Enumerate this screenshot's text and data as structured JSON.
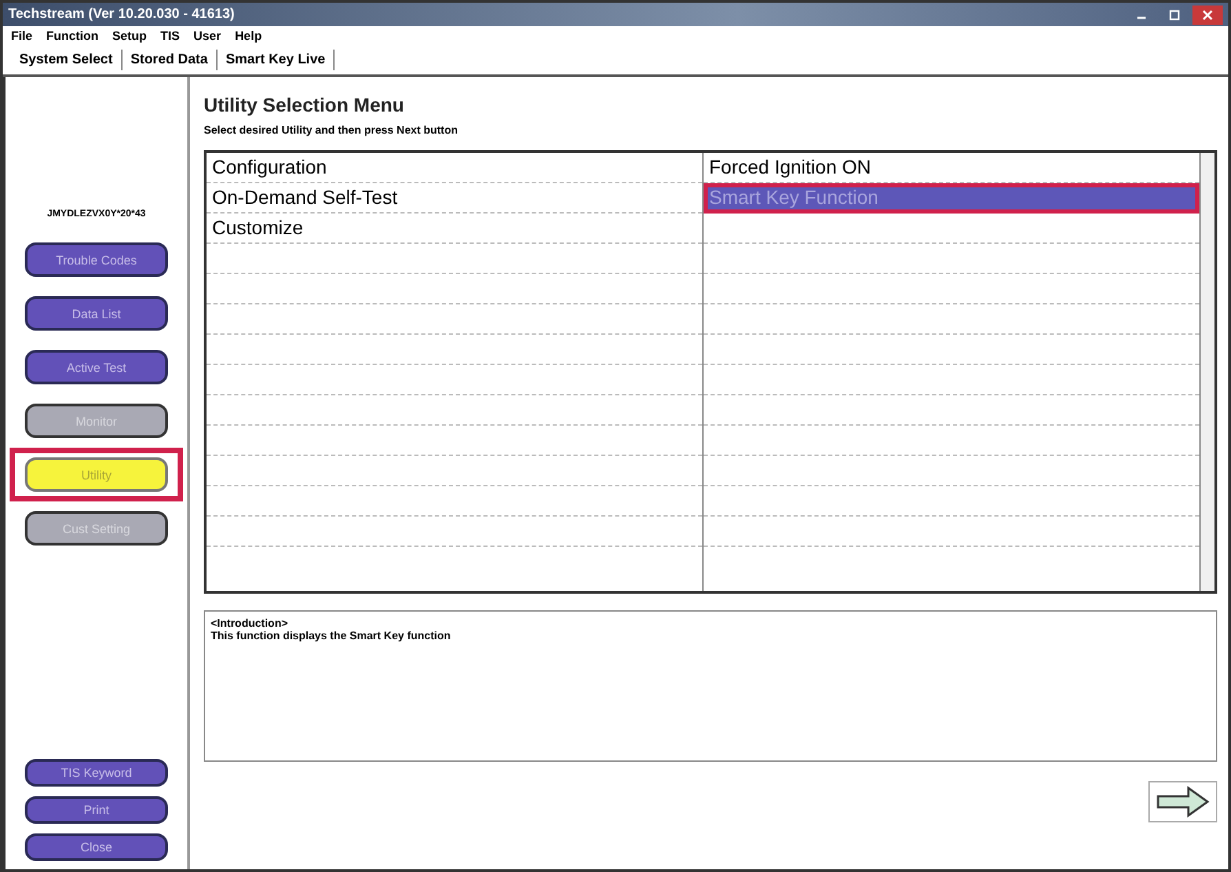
{
  "window": {
    "title": "Techstream (Ver 10.20.030 - 41613)"
  },
  "menu": [
    "File",
    "Function",
    "Setup",
    "TIS",
    "User",
    "Help"
  ],
  "tabs": [
    "System Select",
    "Stored Data",
    "Smart Key Live"
  ],
  "sidebar": {
    "vehicle_id": "JMYDLEZVX0Y*20*43",
    "buttons": [
      {
        "label": "Trouble Codes",
        "disabled": false,
        "selected": false,
        "highlighted": false
      },
      {
        "label": "Data List",
        "disabled": false,
        "selected": false,
        "highlighted": false
      },
      {
        "label": "Active Test",
        "disabled": false,
        "selected": false,
        "highlighted": false
      },
      {
        "label": "Monitor",
        "disabled": true,
        "selected": false,
        "highlighted": false
      },
      {
        "label": "Utility",
        "disabled": false,
        "selected": true,
        "highlighted": true
      },
      {
        "label": "Cust Setting",
        "disabled": true,
        "selected": false,
        "highlighted": false
      }
    ],
    "bottom_buttons": [
      "TIS Keyword",
      "Print",
      "Close"
    ]
  },
  "heading": "Utility Selection Menu",
  "instruction": "Select desired Utility and then press Next button",
  "utility_columns": [
    {
      "items": [
        {
          "label": "Configuration",
          "selected": false,
          "highlighted": false
        },
        {
          "label": "On-Demand Self-Test",
          "selected": false,
          "highlighted": false
        },
        {
          "label": "Customize",
          "selected": false,
          "highlighted": false
        }
      ]
    },
    {
      "items": [
        {
          "label": "Forced Ignition ON",
          "selected": false,
          "highlighted": false
        },
        {
          "label": "Smart Key Function",
          "selected": true,
          "highlighted": true
        }
      ]
    }
  ],
  "description": {
    "heading": "<Introduction>",
    "text": "This function displays the Smart Key function"
  }
}
